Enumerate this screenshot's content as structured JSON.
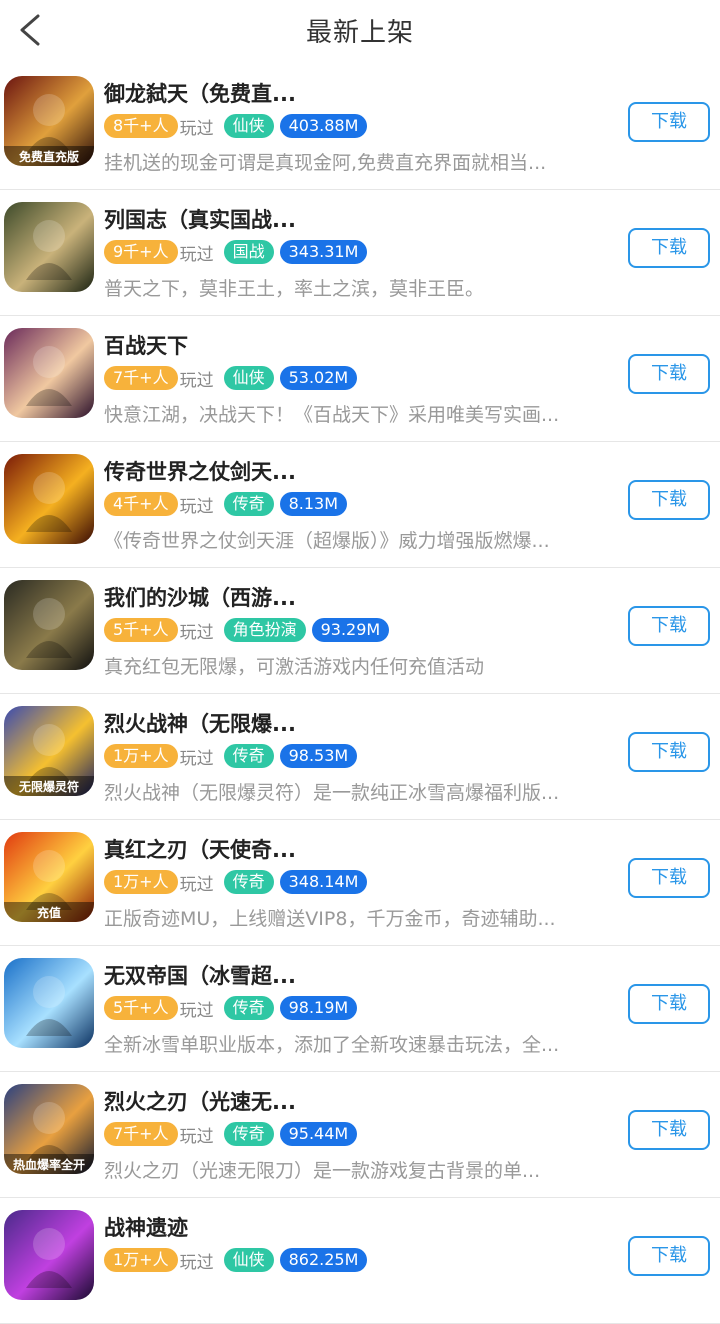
{
  "header": {
    "title": "最新上架",
    "back_icon": "chevron-left-icon"
  },
  "colors": {
    "plays": "#f7b23b",
    "category": "#2ec7a4",
    "size": "#1a73e8",
    "button": "#2a96e8"
  },
  "items": [
    {
      "name": "御龙弑天（免费直...",
      "plays": "8千+人",
      "plays_suffix": "玩过",
      "category": "仙侠",
      "size": "403.88M",
      "desc": "挂机送的现金可谓是真现金阿,免费直充界面就相当...",
      "button": "下载",
      "icon_overlay": "免费直充版",
      "icon_colors": [
        "#6b1410",
        "#e0a03c",
        "#2a0c08"
      ]
    },
    {
      "name": "列国志（真实国战...",
      "plays": "9千+人",
      "plays_suffix": "玩过",
      "category": "国战",
      "size": "343.31M",
      "desc": "普天之下，莫非王土，率土之滨，莫非王臣。",
      "button": "下载",
      "icon_overlay": "",
      "icon_colors": [
        "#3d4a2a",
        "#c9b27a",
        "#1b2312"
      ]
    },
    {
      "name": "百战天下",
      "plays": "7千+人",
      "plays_suffix": "玩过",
      "category": "仙侠",
      "size": "53.02M",
      "desc": "快意江湖，决战天下！《百战天下》采用唯美写实画...",
      "button": "下载",
      "icon_overlay": "",
      "icon_colors": [
        "#6a2a5a",
        "#f0c8a0",
        "#2a0f2a"
      ]
    },
    {
      "name": "传奇世界之仗剑天...",
      "plays": "4千+人",
      "plays_suffix": "玩过",
      "category": "传奇",
      "size": "8.13M",
      "desc": "《传奇世界之仗剑天涯（超爆版）》威力增强版燃爆...",
      "button": "下载",
      "icon_overlay": "",
      "icon_colors": [
        "#7a1a08",
        "#f5b020",
        "#3a0a04"
      ]
    },
    {
      "name": "我们的沙城（西游...",
      "plays": "5千+人",
      "plays_suffix": "玩过",
      "category": "角色扮演",
      "size": "93.29M",
      "desc": "真充红包无限爆，可激活游戏内任何充值活动",
      "button": "下载",
      "icon_overlay": "",
      "icon_colors": [
        "#2a2a22",
        "#8a7a4a",
        "#101010"
      ]
    },
    {
      "name": "烈火战神（无限爆...",
      "plays": "1万+人",
      "plays_suffix": "玩过",
      "category": "传奇",
      "size": "98.53M",
      "desc": "烈火战神（无限爆灵符）是一款纯正冰雪高爆福利版...",
      "button": "下载",
      "icon_overlay": "无限爆灵符",
      "icon_colors": [
        "#3a4ab0",
        "#f5c030",
        "#1a2060"
      ]
    },
    {
      "name": "真红之刃（天使奇...",
      "plays": "1万+人",
      "plays_suffix": "玩过",
      "category": "传奇",
      "size": "348.14M",
      "desc": "正版奇迹MU，上线赠送VIP8，千万金币，奇迹辅助...",
      "button": "下载",
      "icon_overlay": "充值",
      "icon_colors": [
        "#e03a10",
        "#ffd040",
        "#8a1a04"
      ]
    },
    {
      "name": "无双帝国（冰雪超...",
      "plays": "5千+人",
      "plays_suffix": "玩过",
      "category": "传奇",
      "size": "98.19M",
      "desc": "全新冰雪单职业版本，添加了全新攻速暴击玩法，全...",
      "button": "下载",
      "icon_overlay": "",
      "icon_colors": [
        "#1a70c8",
        "#a8e0ff",
        "#0a3060"
      ]
    },
    {
      "name": "烈火之刃（光速无...",
      "plays": "7千+人",
      "plays_suffix": "玩过",
      "category": "传奇",
      "size": "95.44M",
      "desc": "烈火之刃（光速无限刀）是一款游戏复古背景的单...",
      "button": "下载",
      "icon_overlay": "热血爆率全开",
      "icon_colors": [
        "#2a4080",
        "#e8a040",
        "#101830"
      ]
    },
    {
      "name": "战神遗迹",
      "plays": "1万+人",
      "plays_suffix": "玩过",
      "category": "仙侠",
      "size": "862.25M",
      "desc": "",
      "button": "下载",
      "icon_overlay": "",
      "icon_colors": [
        "#4a2a8a",
        "#c040e0",
        "#1a0a30"
      ]
    }
  ]
}
